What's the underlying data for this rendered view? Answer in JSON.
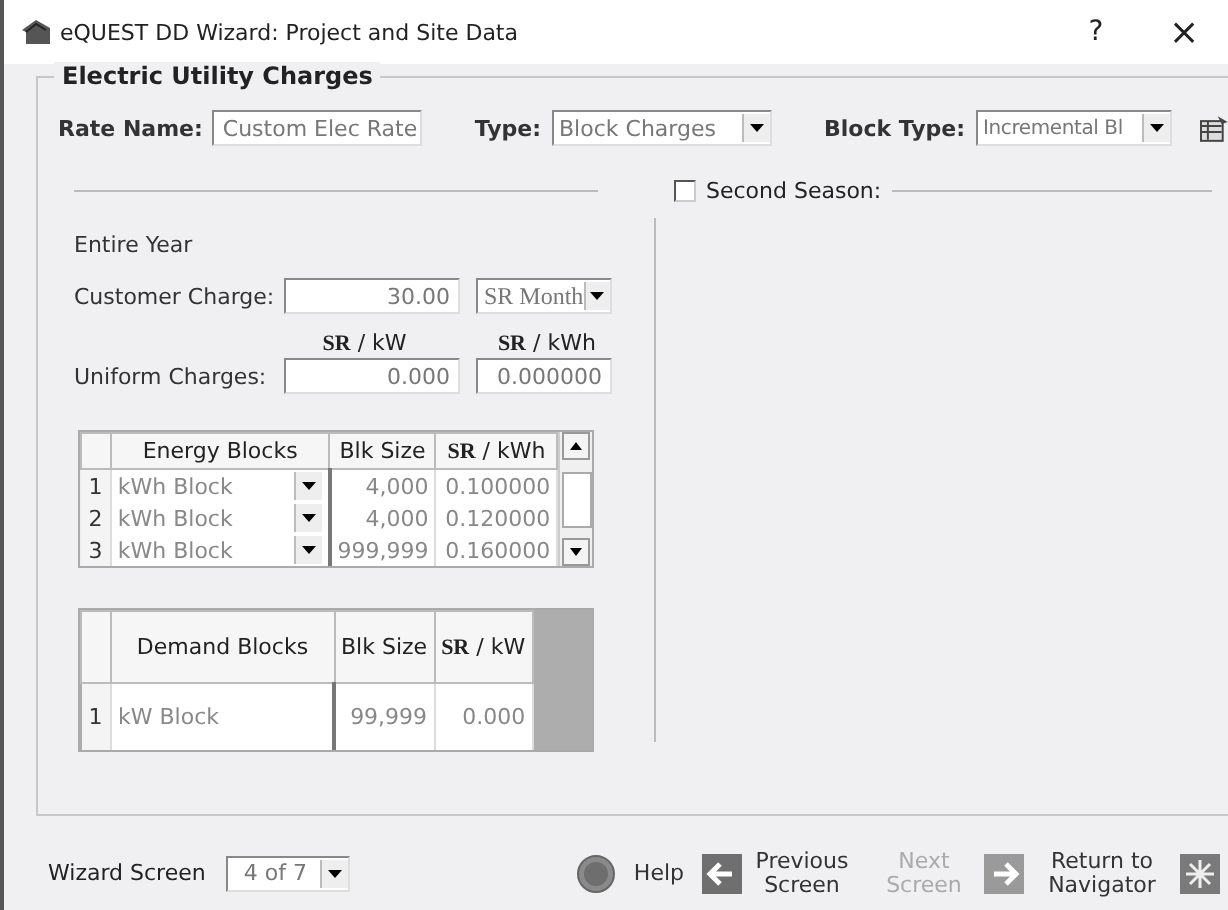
{
  "window": {
    "title": "eQUEST DD Wizard:  Project and Site Data",
    "help": "?",
    "close": "×"
  },
  "group_title": "Electric Utility Charges",
  "rate_name": {
    "label": "Rate Name:",
    "value": "Custom Elec Rate"
  },
  "type": {
    "label": "Type:",
    "value": "Block Charges"
  },
  "block_type": {
    "label": "Block Type:",
    "value": "Incremental Bl"
  },
  "second_season": {
    "label": "Second Season:",
    "checked": false
  },
  "season_label": "Entire Year",
  "customer_charge": {
    "label": "Customer Charge:",
    "value": "30.00",
    "unit": "SR Month"
  },
  "uniform_charges": {
    "label": "Uniform Charges:",
    "columns": [
      {
        "heading": "**SR** / kW",
        "value": "0.000"
      },
      {
        "heading": "**SR** / kWh",
        "value": "0.000000"
      }
    ]
  },
  "energy_blocks": {
    "columns": [
      "Energy Blocks",
      "Blk Size",
      "**SR** / kWh"
    ],
    "rows": [
      {
        "number": "1",
        "block": "kWh Block",
        "size": "4,000",
        "rate": "0.100000"
      },
      {
        "number": "2",
        "block": "kWh Block",
        "size": "4,000",
        "rate": "0.120000"
      },
      {
        "number": "3",
        "block": "kWh Block",
        "size": "999,999",
        "rate": "0.160000"
      }
    ]
  },
  "demand_blocks": {
    "columns": [
      "Demand Blocks",
      "Blk Size",
      "**SR** / kW"
    ],
    "rows": [
      {
        "number": "1",
        "block": "kW Block",
        "size": "99,999",
        "rate": "0.000"
      }
    ]
  },
  "footer": {
    "wizard_label": "Wizard Screen",
    "wizard_value": "4 of 7",
    "help": "Help",
    "previous": {
      "label": "Previous Screen",
      "disabled": false
    },
    "next": {
      "label": "Next Screen",
      "disabled": true
    },
    "return": "Return to Navigator"
  }
}
